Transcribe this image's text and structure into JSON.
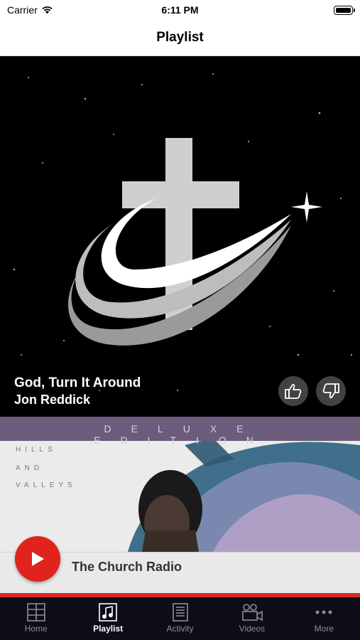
{
  "status_bar": {
    "carrier": "Carrier",
    "time": "6:11 PM"
  },
  "nav": {
    "title": "Playlist"
  },
  "now_playing": {
    "title": "God, Turn It Around",
    "artist": "Jon Reddick"
  },
  "next_album": {
    "banner": "DELUXE EDITION",
    "lines": [
      "HILLS",
      "AND",
      "VALLEYS"
    ]
  },
  "mini_player": {
    "station": "The Church Radio"
  },
  "tabs": [
    {
      "label": "Home",
      "icon": "grid-icon"
    },
    {
      "label": "Playlist",
      "icon": "music-note-icon",
      "active": true
    },
    {
      "label": "Activity",
      "icon": "list-document-icon"
    },
    {
      "label": "Videos",
      "icon": "video-camera-icon"
    },
    {
      "label": "More",
      "icon": "more-dots-icon"
    }
  ],
  "colors": {
    "accent": "#e0231c",
    "tab_bar": "#0d0d1a",
    "album_band": "#6a5c7a"
  }
}
